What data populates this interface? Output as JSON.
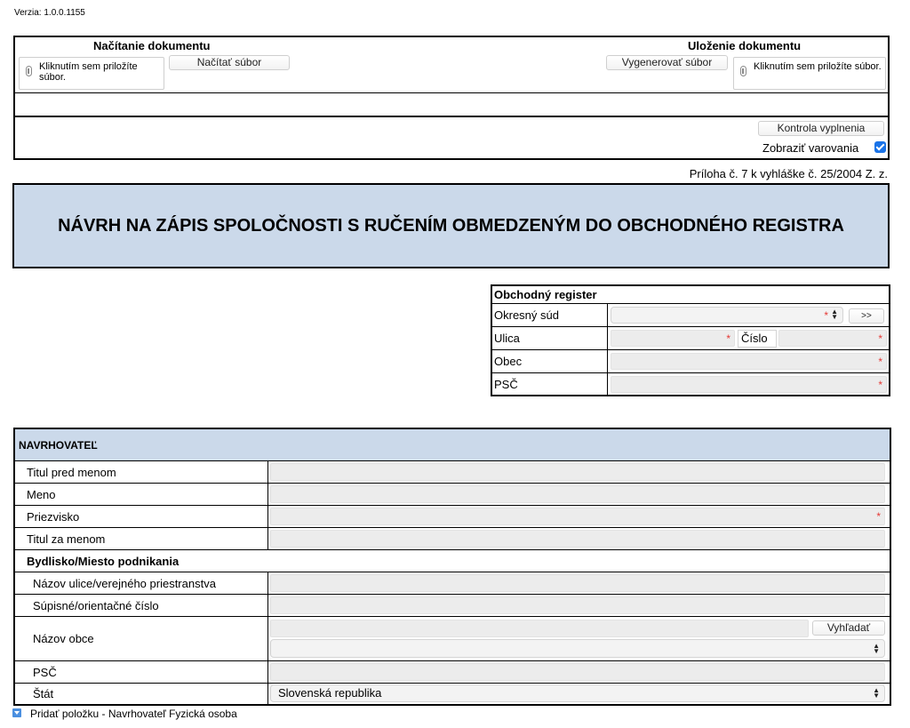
{
  "version": "Verzia: 1.0.0.1155",
  "toolbar": {
    "load_title": "Načítanie dokumentu",
    "save_title": "Uloženie dokumentu",
    "attach_text": "Kliknutím sem priložíte súbor.",
    "load_button": "Načítať súbor",
    "generate_button": "Vygenerovať súbor",
    "check_button": "Kontrola vyplnenia",
    "show_warnings_label": "Zobraziť varovania",
    "show_warnings_checked": true
  },
  "annex": "Príloha č. 7 k vyhláške č. 25/2004 Z. z.",
  "form_title": "NÁVRH NA ZÁPIS SPOLOČNOSTI S RUČENÍM OBMEDZENÝM DO OBCHODNÉHO REGISTRA",
  "register": {
    "title": "Obchodný register",
    "court_label": "Okresný súd",
    "court_button": ">>",
    "street_label": "Ulica",
    "number_label": "Číslo",
    "city_label": "Obec",
    "zip_label": "PSČ"
  },
  "applicant": {
    "title": "NAVRHOVATEĽ",
    "title_before": "Titul pred menom",
    "first_name": "Meno",
    "surname": "Priezvisko",
    "title_after": "Titul za menom",
    "residence_heading": "Bydlisko/Miesto podnikania",
    "street": "Názov ulice/verejného priestranstva",
    "house_number": "Súpisné/orientačné číslo",
    "city": "Názov obce",
    "search_button": "Vyhľadať",
    "zip": "PSČ",
    "country": "Štát",
    "country_value": "Slovenská republika"
  },
  "add_item": "Pridať položku - Navrhovateľ Fyzická osoba",
  "colors": {
    "header_bg": "#cbd9ea",
    "field_bg": "#ececec",
    "required": "#e53935",
    "checkbox": "#1a73e8"
  }
}
